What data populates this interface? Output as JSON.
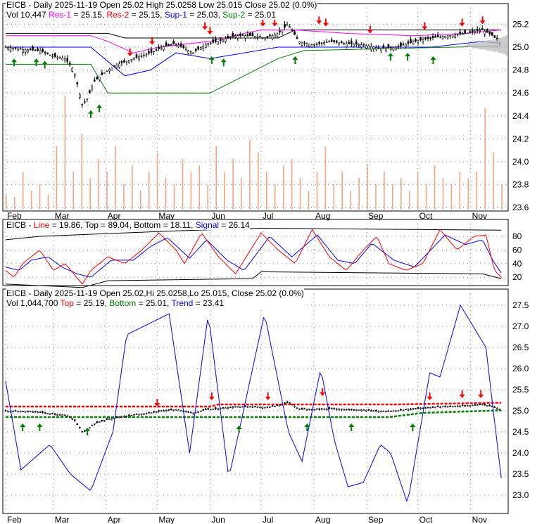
{
  "colors": {
    "res1": "#ff00ff",
    "res2": "#ff0000",
    "sup1": "#0000ff",
    "sup2": "#008000",
    "volume": "#f4a582",
    "line": "#ff0000",
    "signal": "#0000ff"
  },
  "header1": {
    "line1": "EICB - Daily 2025-11-19 Open 25.02  High 25.0258  Low 25.015  Close 25.02 (0.0%)",
    "vol": "Vol 10,447 ",
    "res1_label": "Res-1",
    "res1_val": " = 25.15, ",
    "res2_label": "Res-2",
    "res2_val": " = 25.15, ",
    "sup1_label": "Sup-1",
    "sup1_val": " = 25.03, ",
    "sup2_label": "Sup-2",
    "sup2_val": " = 25.01"
  },
  "header2": {
    "prefix": "EICB - ",
    "line_label": "Line",
    "line_val": " = 19.86, Top = 89.04, Bottom = 18.11, ",
    "signal_label": "Signal",
    "signal_val": " = 26.14"
  },
  "header3": {
    "line1": "EICB - Daily 2025-11-19 Open 25.02,Hi 25.0258,Lo 25.015, Close 25.02 (0.0%)",
    "vol": "Vol 1,044,700 ",
    "top_label": "Top",
    "top_val": " = 25.19, ",
    "bottom_label": "Bottom",
    "bottom_val": " = 25.01, ",
    "trend_label": "Trend",
    "trend_val": " = 23.41"
  },
  "chart_data": [
    {
      "type": "candlestick",
      "title": "EICB - Daily price with support/resistance",
      "xticks": [
        "Feb",
        "Mar",
        "Apr",
        "May",
        "Jun",
        "Jul",
        "Aug",
        "Sep",
        "Oct",
        "Nov"
      ],
      "yticks": [
        "25.2",
        "25.0",
        "24.8",
        "24.6",
        "24.4",
        "24.2",
        "24.0",
        "23.8",
        "23.6"
      ],
      "ylim": [
        23.6,
        25.3
      ],
      "close": [
        [
          0,
          25.0
        ],
        [
          10,
          24.98
        ],
        [
          20,
          24.97
        ],
        [
          28,
          24.92
        ],
        [
          35,
          24.9
        ],
        [
          40,
          24.8
        ],
        [
          45,
          24.5
        ],
        [
          48,
          24.55
        ],
        [
          52,
          24.7
        ],
        [
          60,
          24.8
        ],
        [
          66,
          24.85
        ],
        [
          75,
          24.9
        ],
        [
          85,
          24.95
        ],
        [
          92,
          25.0
        ],
        [
          100,
          25.03
        ],
        [
          110,
          24.95
        ],
        [
          118,
          25.03
        ],
        [
          125,
          25.05
        ],
        [
          135,
          25.1
        ],
        [
          145,
          25.1
        ],
        [
          152,
          25.08
        ],
        [
          160,
          25.12
        ],
        [
          166,
          25.2
        ],
        [
          172,
          25.05
        ],
        [
          180,
          25.02
        ],
        [
          190,
          25.05
        ],
        [
          200,
          25.03
        ],
        [
          210,
          25.02
        ],
        [
          220,
          24.99
        ],
        [
          230,
          25.0
        ],
        [
          240,
          25.05
        ],
        [
          250,
          25.08
        ],
        [
          260,
          25.1
        ],
        [
          270,
          25.12
        ],
        [
          280,
          25.15
        ],
        [
          286,
          25.1
        ],
        [
          291,
          25.02
        ]
      ],
      "volume_rel": [
        0.12,
        0.1,
        0.3,
        0.15,
        0.2,
        0.12,
        0.5,
        0.9,
        0.3,
        0.6,
        0.25,
        0.4,
        0.3,
        0.5,
        0.2,
        0.35,
        0.15,
        0.3,
        0.45,
        0.25,
        0.2,
        0.4,
        0.3,
        0.35,
        0.2,
        0.5,
        0.3,
        0.4,
        0.25,
        0.55,
        0.45,
        0.3,
        0.2,
        0.35,
        0.4,
        0.25,
        0.15,
        0.3,
        0.5,
        0.2,
        0.3,
        0.15,
        0.25,
        0.35,
        0.2,
        0.3,
        0.2,
        0.25,
        0.15,
        0.3,
        0.2,
        0.35,
        0.25,
        0.2,
        0.3,
        0.25,
        0.3,
        0.8,
        0.45,
        0.2
      ],
      "res1": [
        [
          0,
          25.1
        ],
        [
          50,
          25.1
        ],
        [
          60,
          25.05
        ],
        [
          75,
          24.95
        ],
        [
          90,
          25.0
        ],
        [
          120,
          25.05
        ],
        [
          140,
          25.12
        ],
        [
          150,
          25.15
        ],
        [
          170,
          25.15
        ],
        [
          200,
          25.12
        ],
        [
          240,
          25.1
        ],
        [
          270,
          25.12
        ],
        [
          291,
          25.15
        ]
      ],
      "sup1": [
        [
          0,
          25.0
        ],
        [
          50,
          25.0
        ],
        [
          70,
          24.75
        ],
        [
          85,
          24.8
        ],
        [
          100,
          24.95
        ],
        [
          120,
          24.9
        ],
        [
          140,
          24.95
        ],
        [
          160,
          25.0
        ],
        [
          200,
          25.0
        ],
        [
          250,
          25.0
        ],
        [
          280,
          25.05
        ],
        [
          291,
          25.03
        ]
      ],
      "sup2": [
        [
          0,
          24.85
        ],
        [
          50,
          24.85
        ],
        [
          60,
          24.6
        ],
        [
          120,
          24.6
        ],
        [
          140,
          24.75
        ],
        [
          160,
          24.9
        ],
        [
          175,
          24.97
        ],
        [
          291,
          25.01
        ]
      ],
      "top_env": [
        [
          0,
          25.12
        ],
        [
          60,
          25.12
        ],
        [
          70,
          25.08
        ],
        [
          160,
          25.08
        ],
        [
          170,
          25.15
        ],
        [
          291,
          25.15
        ]
      ],
      "arrows_up": [
        [
          5,
          24.9
        ],
        [
          18,
          24.9
        ],
        [
          23,
          24.88
        ],
        [
          50,
          24.45
        ],
        [
          55,
          24.5
        ],
        [
          121,
          24.92
        ],
        [
          128,
          24.9
        ],
        [
          170,
          24.92
        ],
        [
          226,
          24.95
        ],
        [
          236,
          24.95
        ],
        [
          251,
          24.92
        ]
      ],
      "arrows_down": [
        [
          73,
          24.92
        ],
        [
          86,
          25.02
        ],
        [
          117,
          25.15
        ],
        [
          120,
          25.11
        ],
        [
          151,
          25.18
        ],
        [
          158,
          25.18
        ],
        [
          184,
          25.2
        ],
        [
          188,
          25.18
        ],
        [
          214,
          25.12
        ],
        [
          246,
          25.15
        ],
        [
          268,
          25.18
        ],
        [
          280,
          25.2
        ]
      ]
    },
    {
      "type": "line",
      "title": "Stochastic",
      "yticks": [
        "80",
        "60",
        "40",
        "20"
      ],
      "ylim": [
        0,
        100
      ],
      "series": [
        {
          "name": "Line",
          "values": [
            [
              0,
              30
            ],
            [
              5,
              20
            ],
            [
              10,
              40
            ],
            [
              20,
              60
            ],
            [
              28,
              30
            ],
            [
              35,
              40
            ],
            [
              45,
              10
            ],
            [
              50,
              30
            ],
            [
              60,
              50
            ],
            [
              70,
              40
            ],
            [
              80,
              60
            ],
            [
              90,
              85
            ],
            [
              100,
              60
            ],
            [
              105,
              40
            ],
            [
              115,
              85
            ],
            [
              125,
              50
            ],
            [
              135,
              25
            ],
            [
              150,
              85
            ],
            [
              160,
              60
            ],
            [
              170,
              40
            ],
            [
              180,
              90
            ],
            [
              190,
              50
            ],
            [
              200,
              30
            ],
            [
              210,
              60
            ],
            [
              218,
              80
            ],
            [
              225,
              40
            ],
            [
              235,
              30
            ],
            [
              245,
              40
            ],
            [
              255,
              90
            ],
            [
              265,
              60
            ],
            [
              275,
              80
            ],
            [
              282,
              82
            ],
            [
              287,
              30
            ],
            [
              291,
              19.86
            ]
          ]
        },
        {
          "name": "Signal",
          "values": [
            [
              0,
              35
            ],
            [
              8,
              30
            ],
            [
              15,
              45
            ],
            [
              25,
              50
            ],
            [
              33,
              35
            ],
            [
              42,
              25
            ],
            [
              50,
              20
            ],
            [
              62,
              45
            ],
            [
              75,
              45
            ],
            [
              85,
              65
            ],
            [
              95,
              78
            ],
            [
              108,
              48
            ],
            [
              118,
              75
            ],
            [
              130,
              45
            ],
            [
              140,
              30
            ],
            [
              155,
              80
            ],
            [
              168,
              50
            ],
            [
              183,
              82
            ],
            [
              195,
              45
            ],
            [
              205,
              40
            ],
            [
              215,
              70
            ],
            [
              228,
              45
            ],
            [
              240,
              35
            ],
            [
              258,
              82
            ],
            [
              270,
              68
            ],
            [
              280,
              75
            ],
            [
              286,
              45
            ],
            [
              291,
              26.14
            ]
          ]
        },
        {
          "name": "Top",
          "values": [
            [
              0,
              75
            ],
            [
              20,
              80
            ],
            [
              100,
              88
            ],
            [
              150,
              92
            ],
            [
              291,
              89
            ]
          ]
        },
        {
          "name": "Bottom",
          "values": [
            [
              0,
              10
            ],
            [
              45,
              5
            ],
            [
              60,
              15
            ],
            [
              145,
              18
            ],
            [
              150,
              28
            ],
            [
              280,
              25
            ],
            [
              291,
              18
            ]
          ]
        }
      ]
    },
    {
      "type": "line",
      "title": "Trend",
      "xticks": [
        "Feb",
        "Mar",
        "Apr",
        "May",
        "Jun",
        "Jul",
        "Aug",
        "Sep",
        "Oct",
        "Nov"
      ],
      "yticks": [
        "27.5",
        "27.0",
        "26.5",
        "26.0",
        "25.5",
        "25.0",
        "24.5",
        "24.0",
        "23.5",
        "23.0"
      ],
      "ylim": [
        22.6,
        27.8
      ],
      "trend": [
        [
          0,
          25.7
        ],
        [
          9,
          23.6
        ],
        [
          26,
          24.2
        ],
        [
          38,
          23.5
        ],
        [
          50,
          23.1
        ],
        [
          63,
          24.5
        ],
        [
          71,
          26.8
        ],
        [
          96,
          27.3
        ],
        [
          108,
          24.0
        ],
        [
          119,
          27.3
        ],
        [
          131,
          23.4
        ],
        [
          152,
          27.3
        ],
        [
          166,
          24.5
        ],
        [
          174,
          23.8
        ],
        [
          185,
          26.0
        ],
        [
          193,
          24.3
        ],
        [
          201,
          23.2
        ],
        [
          210,
          23.3
        ],
        [
          220,
          24.2
        ],
        [
          226,
          24.0
        ],
        [
          236,
          22.8
        ],
        [
          249,
          25.9
        ],
        [
          255,
          25.8
        ],
        [
          267,
          27.5
        ],
        [
          282,
          26.5
        ],
        [
          286,
          25.1
        ],
        [
          291,
          23.4
        ]
      ],
      "top": [
        [
          0,
          25.1
        ],
        [
          120,
          25.1
        ],
        [
          125,
          25.15
        ],
        [
          230,
          25.15
        ],
        [
          291,
          25.19
        ]
      ],
      "bottom": [
        [
          0,
          24.85
        ],
        [
          225,
          24.85
        ],
        [
          245,
          24.95
        ],
        [
          291,
          25.01
        ]
      ],
      "arrows_up": [
        [
          10,
          24.7
        ],
        [
          20,
          24.7
        ],
        [
          48,
          24.6
        ],
        [
          137,
          24.65
        ],
        [
          177,
          24.7
        ],
        [
          203,
          24.7
        ],
        [
          239,
          24.7
        ]
      ],
      "arrows_down": [
        [
          89,
          25.1
        ],
        [
          121,
          25.25
        ],
        [
          154,
          25.25
        ],
        [
          186,
          25.35
        ],
        [
          249,
          25.25
        ],
        [
          268,
          25.3
        ],
        [
          279,
          25.3
        ]
      ]
    }
  ]
}
